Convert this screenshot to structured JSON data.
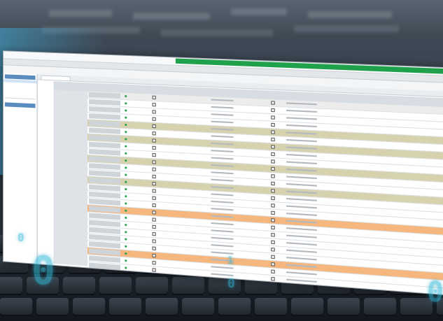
{
  "window": {
    "title": "",
    "brand": "",
    "controls": [
      "–",
      "□",
      "×"
    ]
  },
  "menu": [],
  "toolbar": [],
  "sidebar": {
    "sections": [],
    "tree": []
  },
  "tabs": [],
  "grid": {
    "headers": [],
    "group_label": "",
    "rows": [
      {
        "style": "gray",
        "name": "",
        "status": "",
        "value": "",
        "detail": "",
        "num": ""
      },
      {
        "style": "plain",
        "name": "",
        "status": "",
        "value": "",
        "detail": "",
        "num": ""
      },
      {
        "style": "plain",
        "name": "",
        "status": "",
        "value": "",
        "detail": "",
        "num": ""
      },
      {
        "style": "plain",
        "name": "",
        "status": "",
        "value": "",
        "detail": "",
        "num": ""
      },
      {
        "style": "olive",
        "name": "",
        "status": "",
        "value": "",
        "detail": "",
        "num": ""
      },
      {
        "style": "plain",
        "name": "",
        "status": "",
        "value": "",
        "detail": "",
        "num": ""
      },
      {
        "style": "olive",
        "name": "",
        "status": "",
        "value": "",
        "detail": "",
        "num": ""
      },
      {
        "style": "plain",
        "name": "",
        "status": "",
        "value": "",
        "detail": "",
        "num": ""
      },
      {
        "style": "plain",
        "name": "",
        "status": "",
        "value": "",
        "detail": "",
        "num": ""
      },
      {
        "style": "olive",
        "name": "",
        "status": "",
        "value": "",
        "detail": "",
        "num": ""
      },
      {
        "style": "plain",
        "name": "",
        "status": "",
        "value": "",
        "detail": "",
        "num": ""
      },
      {
        "style": "plain",
        "name": "",
        "status": "",
        "value": "",
        "detail": "",
        "num": ""
      },
      {
        "style": "olive",
        "name": "",
        "status": "",
        "value": "",
        "detail": "",
        "num": ""
      },
      {
        "style": "plain",
        "name": "",
        "status": "",
        "value": "",
        "detail": "",
        "num": ""
      },
      {
        "style": "plain",
        "name": "",
        "status": "",
        "value": "",
        "detail": "",
        "num": ""
      },
      {
        "style": "plain",
        "name": "",
        "status": "",
        "value": "",
        "detail": "",
        "num": ""
      },
      {
        "style": "orange",
        "name": "",
        "status": "",
        "value": "",
        "detail": "",
        "num": ""
      },
      {
        "style": "plain",
        "name": "",
        "status": "",
        "value": "",
        "detail": "",
        "num": ""
      },
      {
        "style": "plain",
        "name": "",
        "status": "",
        "value": "",
        "detail": "",
        "num": ""
      },
      {
        "style": "plain",
        "name": "",
        "status": "",
        "value": "",
        "detail": "",
        "num": ""
      },
      {
        "style": "plain",
        "name": "",
        "status": "",
        "value": "",
        "detail": "",
        "num": ""
      },
      {
        "style": "plain",
        "name": "",
        "status": "",
        "value": "",
        "detail": "",
        "num": ""
      },
      {
        "style": "orange",
        "name": "",
        "status": "",
        "value": "",
        "detail": "",
        "num": ""
      },
      {
        "style": "plain",
        "name": "",
        "status": "",
        "value": "",
        "detail": "",
        "num": ""
      },
      {
        "style": "plain",
        "name": "",
        "status": "",
        "value": "",
        "detail": "",
        "num": ""
      }
    ]
  },
  "colors": {
    "brand_green": "#1fa04a",
    "row_highlight_olive": "#d6d2ad",
    "row_highlight_orange": "#f5b77d",
    "binary_digit_cyan": "#31b9d8"
  },
  "background_digits": [
    "0",
    "0",
    "1",
    "0",
    "0"
  ]
}
